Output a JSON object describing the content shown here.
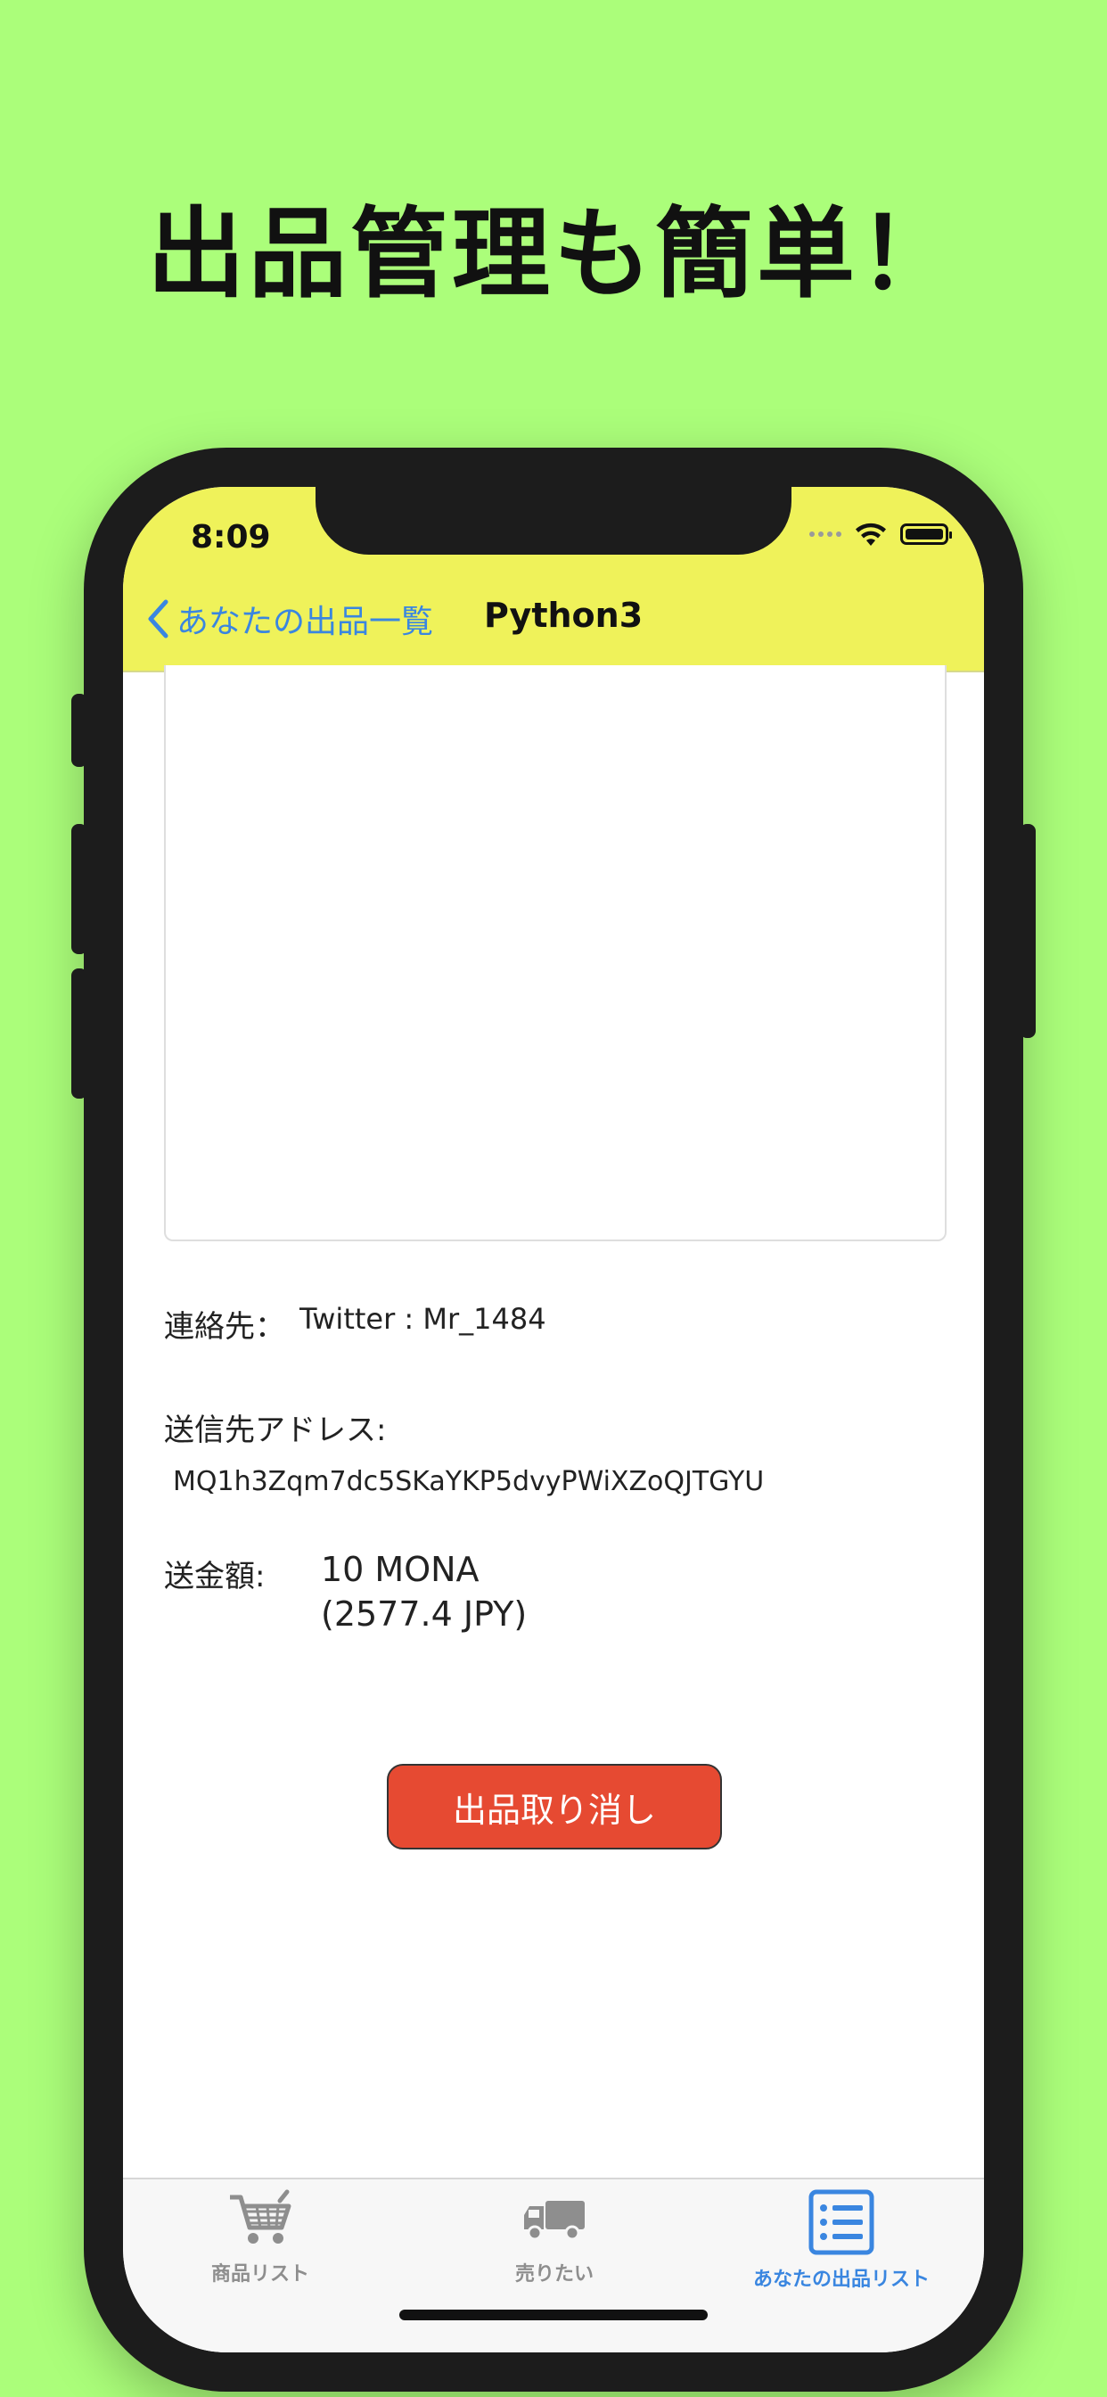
{
  "headline": "出品管理も簡単！",
  "status_bar": {
    "time": "8:09"
  },
  "nav": {
    "back_label": "あなたの出品一覧",
    "title": "Python3"
  },
  "contact": {
    "label": "連絡先：",
    "value": "Twitter : Mr_1484"
  },
  "address": {
    "label": "送信先アドレス:",
    "value": "MQ1h3Zqm7dc5SKaYKP5dvyPWiXZoQJTGYU"
  },
  "amount": {
    "label": "送金額:",
    "mona": "10 MONA",
    "jpy": "(2577.4 JPY)"
  },
  "cancel_button": "出品取り消し",
  "tabs": [
    {
      "label": "商品リスト",
      "icon": "cart-icon",
      "active": false
    },
    {
      "label": "売りたい",
      "icon": "truck-icon",
      "active": false
    },
    {
      "label": "あなたの出品リスト",
      "icon": "list-icon",
      "active": true
    }
  ],
  "colors": {
    "background": "#abfe7a",
    "nav_bar": "#eff25a",
    "accent": "#3a86e0",
    "cancel": "#e64a32",
    "tab_inactive": "#8e8e8e"
  }
}
